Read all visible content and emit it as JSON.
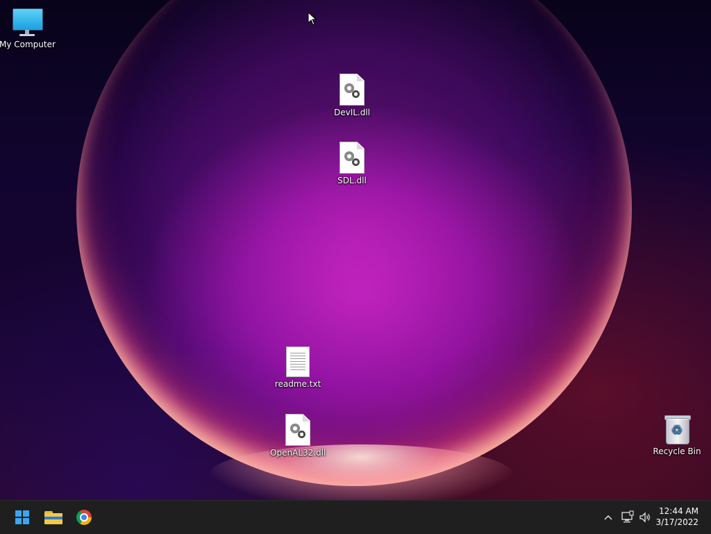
{
  "desktop": {
    "icons": {
      "my_computer": "My Computer",
      "devil": "DevIL.dll",
      "sdl": "SDL.dll",
      "readme": "readme.txt",
      "openal": "OpenAL32.dll",
      "recycle_bin": "Recycle Bin"
    }
  },
  "taskbar": {
    "start_icon": "windows-start-icon",
    "pinned": [
      "file-explorer-icon",
      "chrome-icon"
    ],
    "tray": {
      "chevron": "^",
      "network_icon": "network-icon",
      "volume_icon": "volume-icon"
    },
    "clock": {
      "time": "12:44 AM",
      "date": "3/17/2022"
    }
  },
  "colors": {
    "taskbar_bg": "#1f1f1f",
    "accent": "#3aa7f2"
  }
}
